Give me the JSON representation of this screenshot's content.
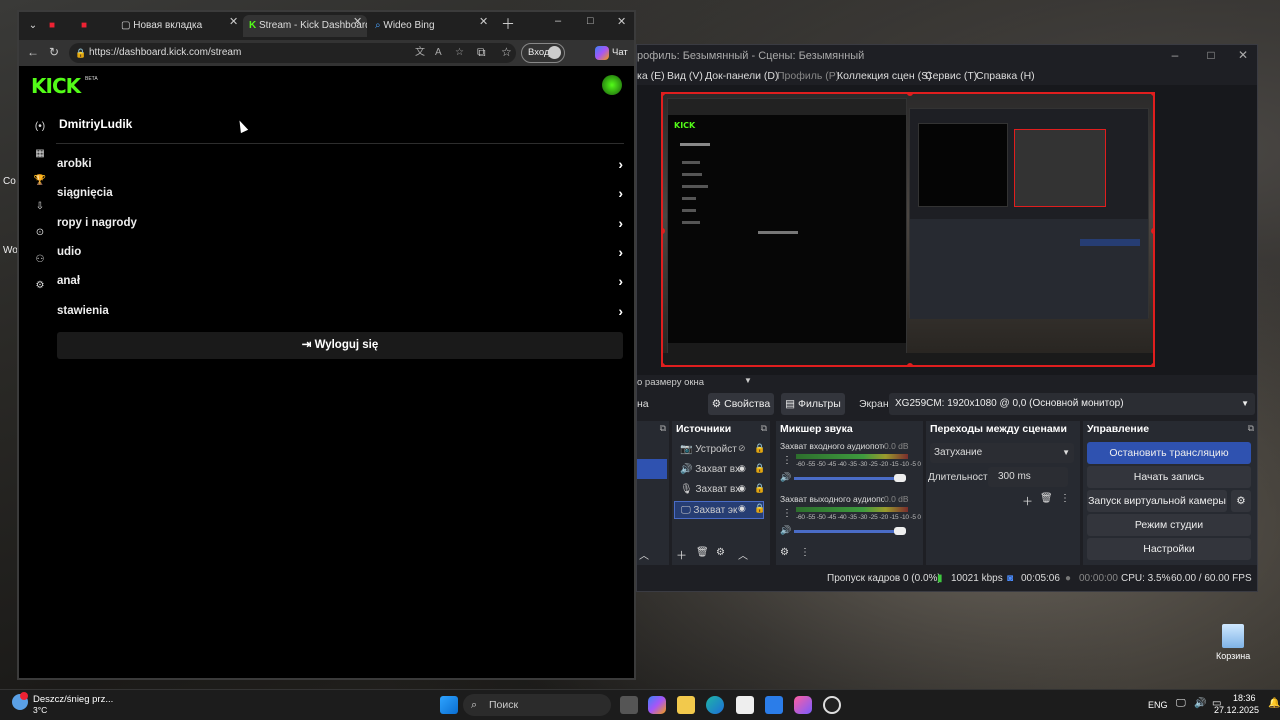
{
  "desktop": {
    "left_fragments": [
      "Co",
      "Wo"
    ],
    "recycle_bin_label": "Корзина"
  },
  "browser": {
    "tabs": [
      {
        "label": "Новая вкладка"
      },
      {
        "label": "Stream - Kick Dashboard"
      },
      {
        "label": "Wideo Bing"
      }
    ],
    "url": "https://dashboard.kick.com/stream",
    "login_label": "Вход",
    "chat_label": "Чат"
  },
  "kick": {
    "logo": "KICK",
    "beta": "BETA",
    "username": "DmitriyLudik",
    "menu": [
      {
        "label": "arobki"
      },
      {
        "label": "siągnięcia"
      },
      {
        "label": "ropy i nagrody"
      },
      {
        "label": "udio"
      },
      {
        "label": "anał"
      },
      {
        "label": "stawienia"
      }
    ],
    "logout": "Wyloguj się",
    "accent": "#53fc18"
  },
  "obs": {
    "title": "рофиль: Безымянный - Сцены: Безымянный",
    "menu": [
      "ка (E)",
      "Вид (V)",
      "Док-панели (D)",
      "Профиль (P)",
      "Коллекция сцен (S)",
      "Сервис (T)",
      "Справка (H)"
    ],
    "size_label": "о размеру окна",
    "scene_fragment": "на",
    "properties": "Свойства",
    "filters": "Фильтры",
    "screen_label": "Экран",
    "screen_value": "XG259CM: 1920x1080 @ 0,0 (Основной монитор)",
    "sources": {
      "title": "Источники",
      "items": [
        {
          "label": "Устройст"
        },
        {
          "label": "Захват вх"
        },
        {
          "label": "Захват вх"
        },
        {
          "label": "Захват эк"
        }
      ]
    },
    "mixer": {
      "title": "Микшер звука",
      "channels": [
        {
          "name": "Захват входного аудиопоток",
          "db": "0.0 dB"
        },
        {
          "name": "Захват выходного аудиопото",
          "db": "0.0 dB"
        }
      ],
      "scale": "-60 -55 -50 -45 -40 -35 -30 -25 -20 -15 -10 -5 0"
    },
    "transitions": {
      "title": "Переходы между сценами",
      "selected": "Затухание",
      "duration_label": "Длительность",
      "duration_value": "300 ms"
    },
    "controls": {
      "title": "Управление",
      "stop_stream": "Остановить трансляцию",
      "start_record": "Начать запись",
      "virtual_cam": "Запуск виртуальной камеры",
      "studio_mode": "Режим студии",
      "settings": "Настройки"
    },
    "status": {
      "dropped": "Пропуск кадров 0 (0.0%)",
      "bitrate": "10021 kbps",
      "stream_time": "00:05:06",
      "rec_time": "00:00:00",
      "cpu": "CPU: 3.5%",
      "fps": "60.00 / 60.00 FPS"
    },
    "accent": "#e01e1e"
  },
  "taskbar": {
    "weather_text": "Deszcz/śnieg prz...",
    "temperature": "3°C",
    "search": "Поиск",
    "lang": "ENG",
    "time": "18:36",
    "date": "27.12.2025"
  }
}
